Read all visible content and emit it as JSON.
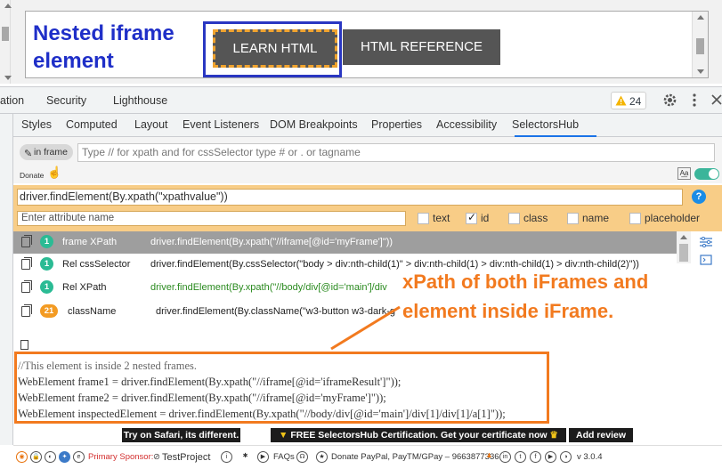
{
  "page": {
    "nested_title": "Nested iframe element",
    "learn_html_label": "LEARN HTML",
    "html_reference_label": "HTML REFERENCE"
  },
  "devtools": {
    "main_tabs": [
      "ation",
      "Security",
      "Lighthouse"
    ],
    "warning_count": "24",
    "sub_tabs": [
      "Styles",
      "Computed",
      "Layout",
      "Event Listeners",
      "DOM Breakpoints",
      "Properties",
      "Accessibility",
      "SelectorsHub"
    ],
    "active_sub_tab": "SelectorsHub"
  },
  "selectorshub": {
    "in_frame_label": "in frame",
    "search_placeholder": "Type // for xpath and for cssSelector type # or . or tagname",
    "donate_label": "Donate",
    "command_value": "driver.findElement(By.xpath(\"xpathvalue\"))",
    "attribute_placeholder": "Enter attribute name",
    "attribute_options": [
      {
        "label": "text",
        "checked": false
      },
      {
        "label": "id",
        "checked": true
      },
      {
        "label": "class",
        "checked": false
      },
      {
        "label": "name",
        "checked": false
      },
      {
        "label": "placeholder",
        "checked": false
      }
    ],
    "results": [
      {
        "count": "1",
        "type": "frame XPath",
        "value": "driver.findElement(By.xpath(\"//iframe[@id='myFrame']\"))",
        "selected": true
      },
      {
        "count": "1",
        "type": "Rel cssSelector",
        "value": "driver.findElement(By.cssSelector(\"body > div:nth-child(1)\" > div:nth-child(1) > div:nth-child(1) > div:nth-child(2)\"))",
        "selected": false
      },
      {
        "count": "1",
        "type": "Rel XPath",
        "value": "driver.findElement(By.xpath(\"//body/div[@id='main']/div",
        "selected": false
      },
      {
        "count": "21",
        "type": "className",
        "value": "driver.findElement(By.className(\"w3-button w3-dark-g",
        "selected": false
      }
    ],
    "code_lines": [
      "//This element is inside 2 nested frames.",
      "WebElement frame1 = driver.findElement(By.xpath(\"//iframe[@id='iframeResult']\"));",
      "WebElement frame2 = driver.findElement(By.xpath(\"//iframe[@id='myFrame']\"));",
      "WebElement inspectedElement = driver.findElement(By.xpath(\"//body/div[@id='main']/div[1]/div[1]/a[1]\"));"
    ]
  },
  "annotation": {
    "text": "xPath of both iFrames and element inside iFrame.",
    "color": "#f27a1f"
  },
  "promos": {
    "safari": "Try on Safari, its different.",
    "certification": "FREE SelectorsHub Certification. Get your certificate now",
    "review": "Add review"
  },
  "footer": {
    "sponsor_label": "Primary Sponsor:",
    "sponsor_name": "TestProject",
    "faqs": "FAQs",
    "donate_text": "Donate PayPal, PayTM/GPay – 9663877336",
    "version": "v 3.0.4"
  },
  "colors": {
    "accent_blue": "#1a73e8",
    "result_badge": "#2bbb94",
    "orange_band": "#f8cd87",
    "title_blue": "#1f2fc8"
  }
}
